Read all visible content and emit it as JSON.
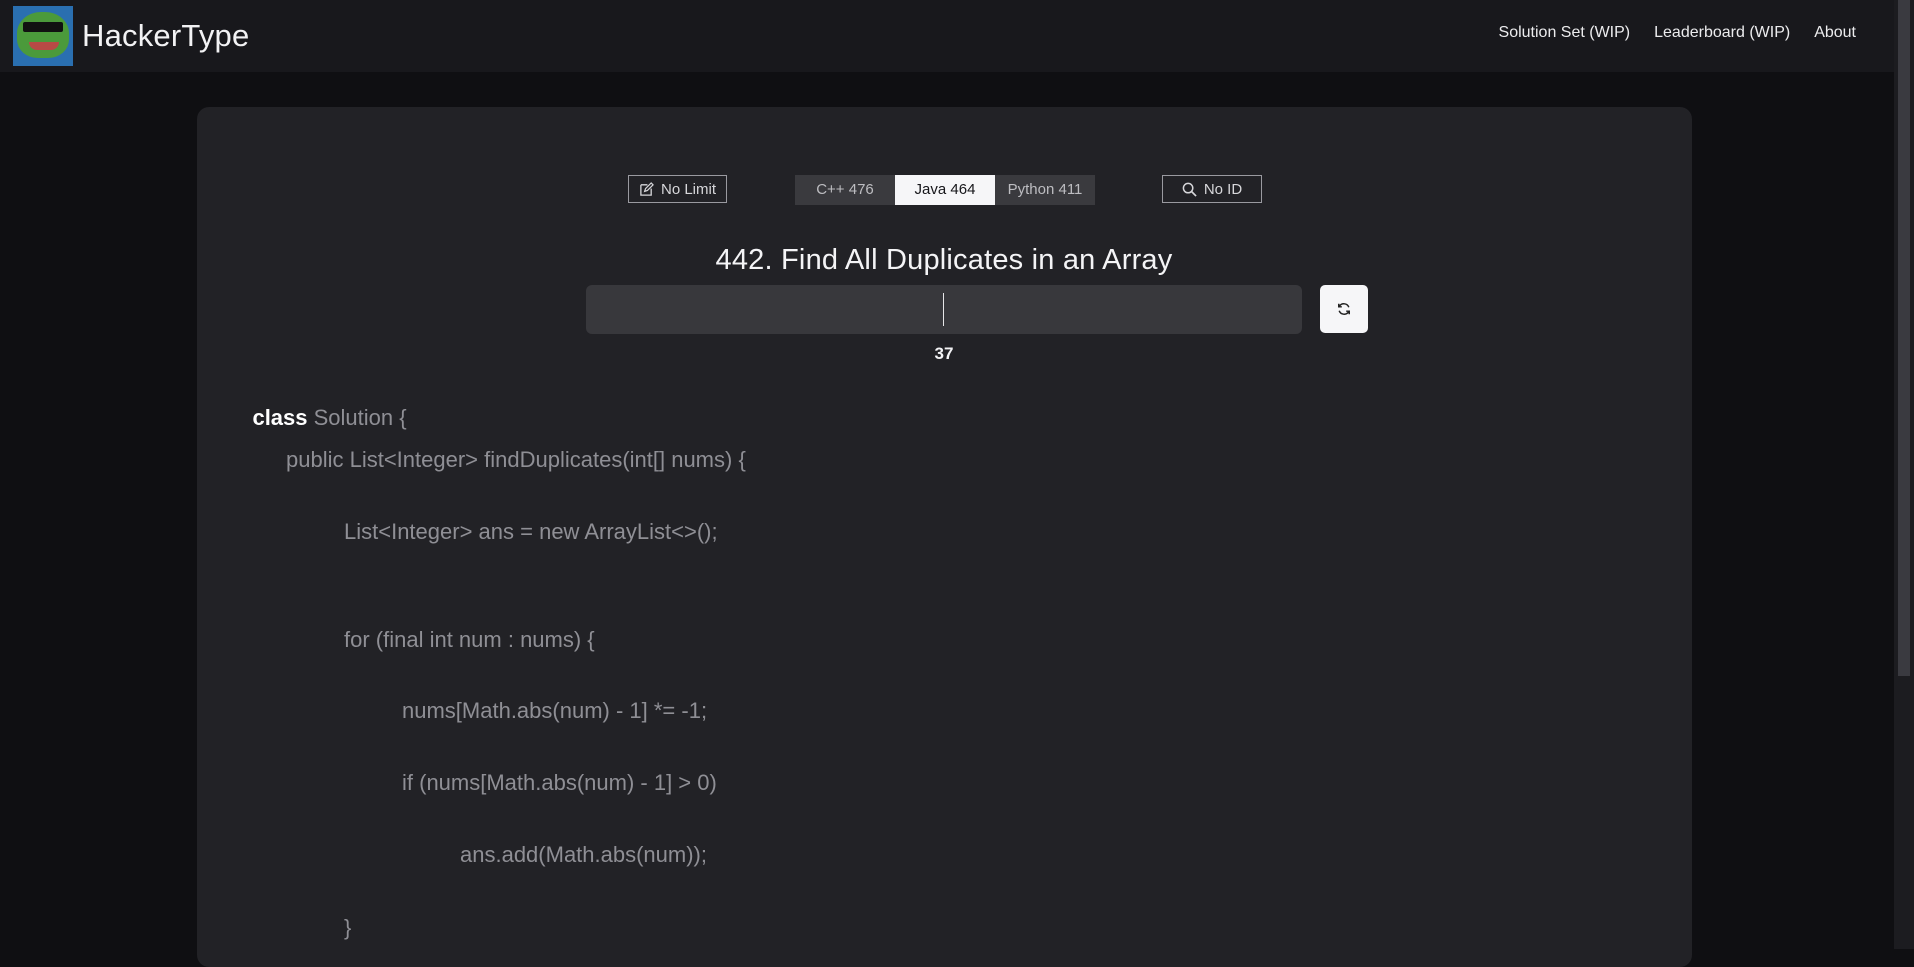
{
  "header": {
    "logo_icon": "frog-sunglasses-logo",
    "title": "HackerType",
    "nav": [
      "Solution Set (WIP)",
      "Leaderboard (WIP)",
      "About"
    ]
  },
  "controls": {
    "limit_label": "No Limit",
    "limit_icon": "edit-icon",
    "languages": [
      {
        "label": "C++ 476",
        "selected": false
      },
      {
        "label": "Java 464",
        "selected": true
      },
      {
        "label": "Python 411",
        "selected": false
      }
    ],
    "id_label": "No ID",
    "id_icon": "search-icon"
  },
  "problem": {
    "title": "442. Find All Duplicates in an Array",
    "counter": "37",
    "reset_icon": "refresh-icon"
  },
  "code": {
    "lines": [
      {
        "keyword": "class",
        "text": " Solution {"
      },
      {
        "keyword": "",
        "text": "public List<Integer> findDuplicates(int[] nums) {"
      },
      {
        "keyword": "",
        "text": "List<Integer> ans = new ArrayList<>();"
      },
      {
        "keyword": "",
        "text": "for (final int num : nums) {"
      },
      {
        "keyword": "",
        "text": "nums[Math.abs(num) - 1] *= -1;"
      },
      {
        "keyword": "",
        "text": "if (nums[Math.abs(num) - 1] > 0)"
      },
      {
        "keyword": "",
        "text": "ans.add(Math.abs(num));"
      },
      {
        "keyword": "",
        "text": "}"
      }
    ]
  },
  "colors": {
    "background": "#0f0f12",
    "header": "#18181c",
    "card": "#222226",
    "selected_tab": "#f6f6f8",
    "code_text": "#8f8f95"
  }
}
